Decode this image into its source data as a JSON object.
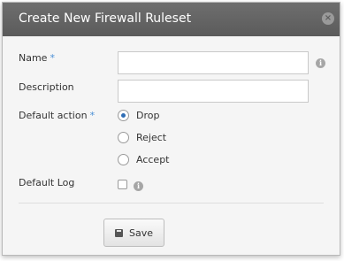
{
  "dialog": {
    "title": "Create New Firewall Ruleset",
    "close_symbol": "×"
  },
  "form": {
    "name": {
      "label": "Name",
      "required_marker": "*",
      "value": "",
      "info_icon": "info-icon"
    },
    "description": {
      "label": "Description",
      "value": ""
    },
    "default_action": {
      "label": "Default action",
      "required_marker": "*",
      "options": [
        {
          "label": "Drop",
          "selected": true
        },
        {
          "label": "Reject",
          "selected": false
        },
        {
          "label": "Accept",
          "selected": false
        }
      ]
    },
    "default_log": {
      "label": "Default Log",
      "checked": false,
      "info_icon": "info-icon"
    }
  },
  "actions": {
    "save_label": "Save",
    "save_icon": "floppy-disk-icon"
  },
  "colors": {
    "titlebar": "#5b5b5b",
    "title_text": "#ffffff",
    "required_marker": "#4a8fd6",
    "radio_selected": "#2f6db5",
    "dialog_bg": "#f5f5f5"
  }
}
